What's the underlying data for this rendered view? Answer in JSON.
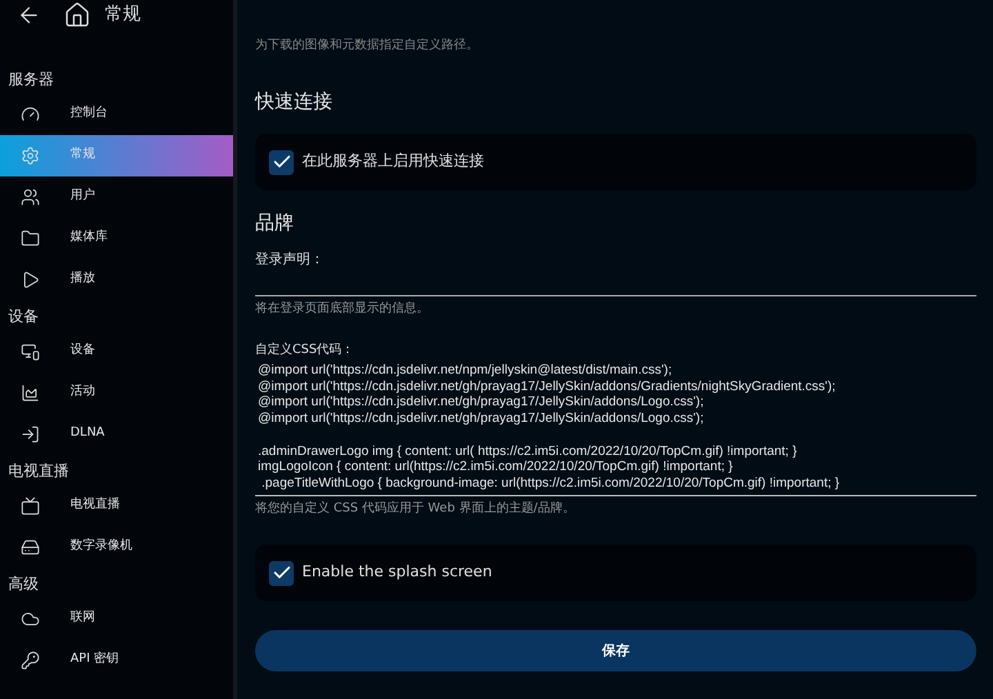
{
  "header": {
    "title": "常规"
  },
  "sidebar": {
    "sections": [
      {
        "title": "服务器",
        "items": [
          {
            "kind": "dashboard",
            "label": "控制台",
            "selected": false
          },
          {
            "kind": "settings",
            "label": "常规",
            "selected": true
          },
          {
            "kind": "users",
            "label": "用户",
            "selected": false
          },
          {
            "kind": "folder",
            "label": "媒体库",
            "selected": false
          },
          {
            "kind": "play",
            "label": "播放",
            "selected": false
          }
        ]
      },
      {
        "title": "设备",
        "items": [
          {
            "kind": "devices",
            "label": "设备",
            "selected": false
          },
          {
            "kind": "activity",
            "label": "活动",
            "selected": false
          },
          {
            "kind": "login",
            "label": "DLNA",
            "selected": false
          }
        ]
      },
      {
        "title": "电视直播",
        "items": [
          {
            "kind": "tv",
            "label": "电视直播",
            "selected": false
          },
          {
            "kind": "dvr",
            "label": "数字录像机",
            "selected": false
          }
        ]
      },
      {
        "title": "高级",
        "items": [
          {
            "kind": "cloud",
            "label": "联网",
            "selected": false
          },
          {
            "kind": "key",
            "label": "API 密钥",
            "selected": false
          }
        ]
      }
    ]
  },
  "main": {
    "top_note": "为下载的图像和元数据指定自定义路径。",
    "quick_connect": {
      "heading": "快速连接",
      "checkbox": {
        "label": "在此服务器上启用快速连接",
        "checked": true
      }
    },
    "branding": {
      "heading": "品牌",
      "login_disclaimer": {
        "label": "登录声明：",
        "hint": "将在登录页面底部显示的信息。"
      },
      "custom_css": {
        "label": "自定义CSS代码：",
        "lines": [
          "@import url('https://cdn.jsdelivr.net/npm/jellyskin@latest/dist/main.css');",
          "@import url('https://cdn.jsdelivr.net/gh/prayag17/JellySkin/addons/Gradients/nightSkyGradient.css');",
          "@import url('https://cdn.jsdelivr.net/gh/prayag17/JellySkin/addons/Logo.css');",
          "@import url('https://cdn.jsdelivr.net/gh/prayag17/JellySkin/addons/Logo.css');"
        ],
        "rule_lines": [
          ".adminDrawerLogo img { content: url( https://c2.im5i.com/2022/10/20/TopCm.gif) !important; }",
          "imgLogoIcon { content: url(https://c2.im5i.com/2022/10/20/TopCm.gif) !important; }",
          " .pageTitleWithLogo { background-image: url(https://c2.im5i.com/2022/10/20/TopCm.gif) !important; }"
        ],
        "hint": "将您的自定义 CSS 代码应用于 Web 界面上的主题/品牌。"
      },
      "splash": {
        "label": "Enable the splash screen",
        "checked": true
      }
    },
    "save_button": "保存"
  }
}
